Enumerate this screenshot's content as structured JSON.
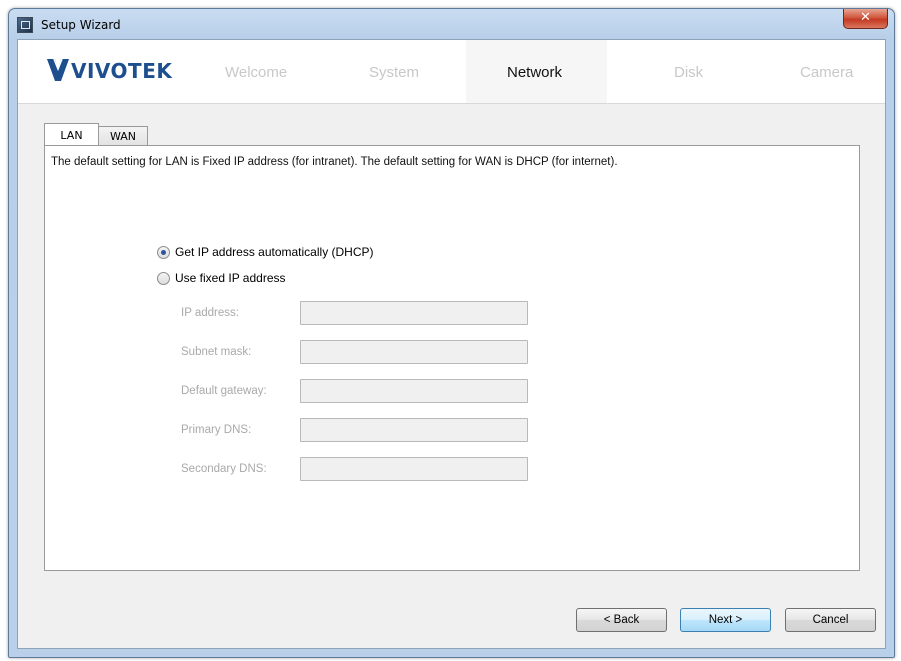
{
  "window": {
    "title": "Setup Wizard",
    "close_symbol": "✕"
  },
  "header": {
    "logo_text": "VIVOTEK",
    "steps": [
      {
        "label": "Welcome",
        "active": false
      },
      {
        "label": "System",
        "active": false
      },
      {
        "label": "Network",
        "active": true
      },
      {
        "label": "Disk",
        "active": false
      },
      {
        "label": "Camera",
        "active": false
      }
    ]
  },
  "tabs": [
    {
      "label": "LAN",
      "selected": true
    },
    {
      "label": "WAN",
      "selected": false
    }
  ],
  "panel": {
    "description": "The default setting for LAN is Fixed IP address (for intranet). The default setting for WAN is DHCP (for internet).",
    "options": [
      {
        "label": "Get IP address automatically (DHCP)",
        "selected": true
      },
      {
        "label": "Use fixed IP address",
        "selected": false
      }
    ],
    "fields": [
      {
        "label": "IP address:",
        "value": ""
      },
      {
        "label": "Subnet mask:",
        "value": ""
      },
      {
        "label": "Default gateway:",
        "value": ""
      },
      {
        "label": "Primary DNS:",
        "value": ""
      },
      {
        "label": "Secondary DNS:",
        "value": ""
      }
    ]
  },
  "buttons": {
    "back": "< Back",
    "next": "Next >",
    "cancel": "Cancel"
  },
  "colors": {
    "logo": "#1d4f8f",
    "inactive_step": "#c8c8c8",
    "disabled_label": "#a9a9a9",
    "close_button": "#c33a21"
  }
}
